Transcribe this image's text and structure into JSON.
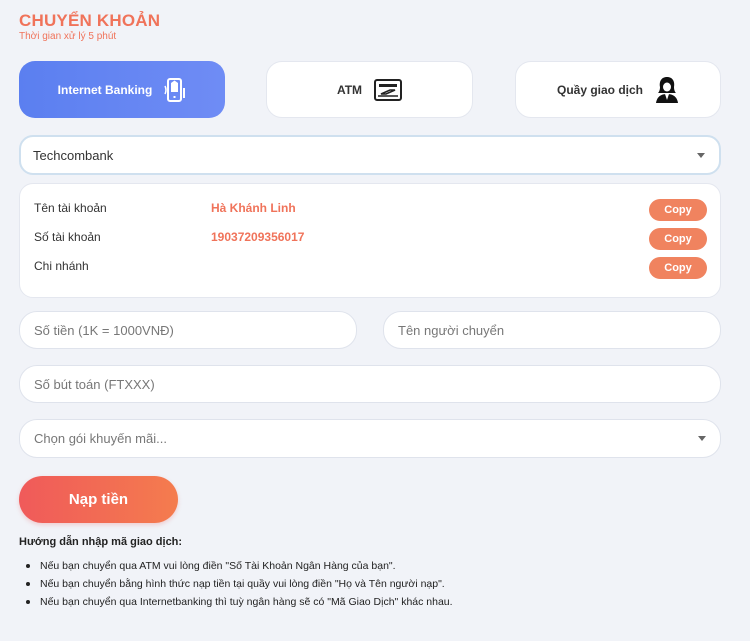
{
  "header": {
    "title": "CHUYỂN KHOẢN",
    "subtitle": "Thời gian xử lý 5 phút"
  },
  "methods": [
    {
      "label": "Internet Banking",
      "icon": "mobile-bank-icon",
      "active": true
    },
    {
      "label": "ATM",
      "icon": "atm-card-icon",
      "active": false
    },
    {
      "label": "Quầy giao dịch",
      "icon": "teller-person-icon",
      "active": false
    }
  ],
  "bank_select": {
    "value": "Techcombank"
  },
  "account_info": {
    "rows": [
      {
        "key": "Tên tài khoản",
        "value": "Hà Khánh Linh"
      },
      {
        "key": "Số tài khoản",
        "value": "19037209356017"
      },
      {
        "key": "Chi nhánh",
        "value": ""
      }
    ],
    "copy_label": "Copy"
  },
  "form": {
    "amount_placeholder": "Số tiền (1K = 1000VNĐ)",
    "sender_placeholder": "Tên người chuyển",
    "ft_placeholder": "Số bút toán (FTXXX)",
    "promo_placeholder": "Chọn gói khuyến mãi..."
  },
  "submit_label": "Nạp tiền",
  "guide": {
    "title": "Hướng dẫn nhập mã giao dịch:",
    "items": [
      "Nếu bạn chuyển qua ATM vui lòng điền \"Số Tài Khoản Ngân Hàng của bạn\".",
      "Nếu bạn chuyển bằng hình thức nạp tiền tại quầy vui lòng điền \"Họ và Tên người nạp\".",
      "Nếu bạn chuyển qua Internetbanking thì tuỳ ngân hàng sẽ có \"Mã Giao Dịch\" khác nhau."
    ]
  },
  "colors": {
    "accent": "#f0735a",
    "active_tab": "#6f8cf5",
    "copy_button": "#f0835f"
  }
}
